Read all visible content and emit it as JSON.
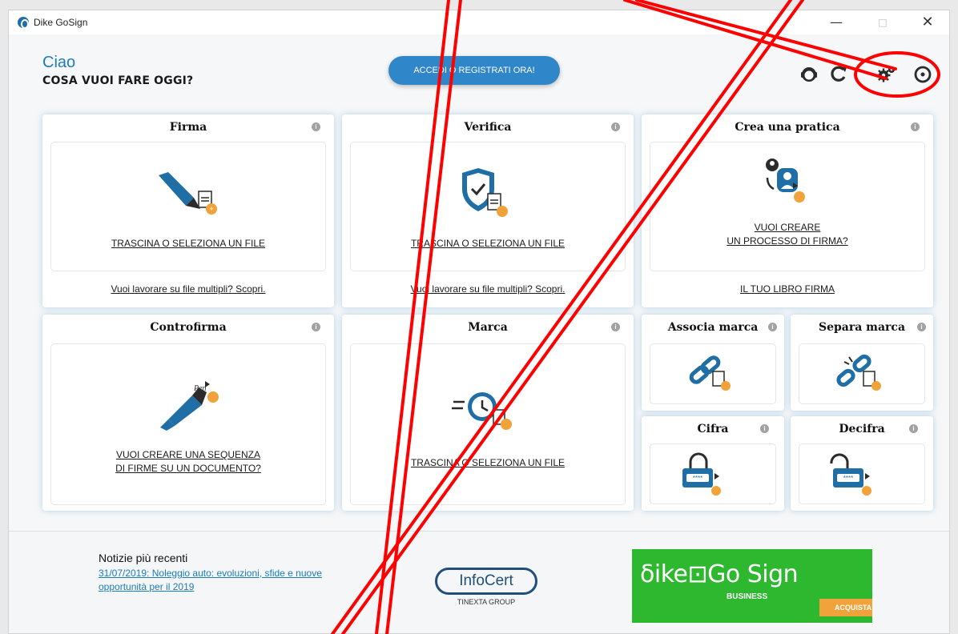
{
  "window": {
    "title": "Dike GoSign",
    "controls": {
      "minimize": "—",
      "maximize": "□",
      "close": "✕"
    }
  },
  "header": {
    "greeting": "Ciao",
    "question": "COSA VUOI FARE OGGI?",
    "login_button": "ACCEDI O REGISTRATI ORA!",
    "icons": [
      "support-icon",
      "refresh-icon",
      "settings-icon",
      "help-icon"
    ]
  },
  "cards": {
    "firma": {
      "title": "Firma",
      "action": "TRASCINA O SELEZIONA UN FILE",
      "footer_link": "Vuoi lavorare su file multipli? Scopri."
    },
    "verifica": {
      "title": "Verifica",
      "action": "TRASCINA O SELEZIONA UN FILE",
      "footer_link": "Vuoi lavorare su file multipli? Scopri."
    },
    "crea_pratica": {
      "title": "Crea una pratica",
      "action_line1": "VUOI CREARE",
      "action_line2": "UN PROCESSO DI FIRMA?",
      "footer_link": "IL TUO LIBRO FIRMA"
    },
    "controfirma": {
      "title": "Controfirma",
      "action_line1": "VUOI CREARE UNA SEQUENZA",
      "action_line2": "DI FIRME SU UN DOCUMENTO?"
    },
    "marca": {
      "title": "Marca",
      "action": "TRASCINA O SELEZIONA UN FILE"
    },
    "associa_marca": {
      "title": "Associa marca"
    },
    "separa_marca": {
      "title": "Separa marca"
    },
    "cifra": {
      "title": "Cifra"
    },
    "decifra": {
      "title": "Decifra"
    },
    "info_glyph": "i"
  },
  "footer": {
    "news_title": "Notizie più recenti",
    "news_link": "31/07/2019: Noleggio auto: evoluzioni, sfide e nuove opportunità per il 2019",
    "brand_name": "InfoCert",
    "brand_group": "TINEXTA GROUP",
    "promo_name": "δike⊡Go Sign",
    "promo_sub": "BUSINESS",
    "promo_cta": "ACQUISTA"
  },
  "colors": {
    "accent": "#2f86c8",
    "greeting": "#1b7db8",
    "icon_blue": "#1f6fa6",
    "icon_orange": "#f2a23a",
    "annotation_red": "#ff0000",
    "promo_green": "#2db830"
  }
}
